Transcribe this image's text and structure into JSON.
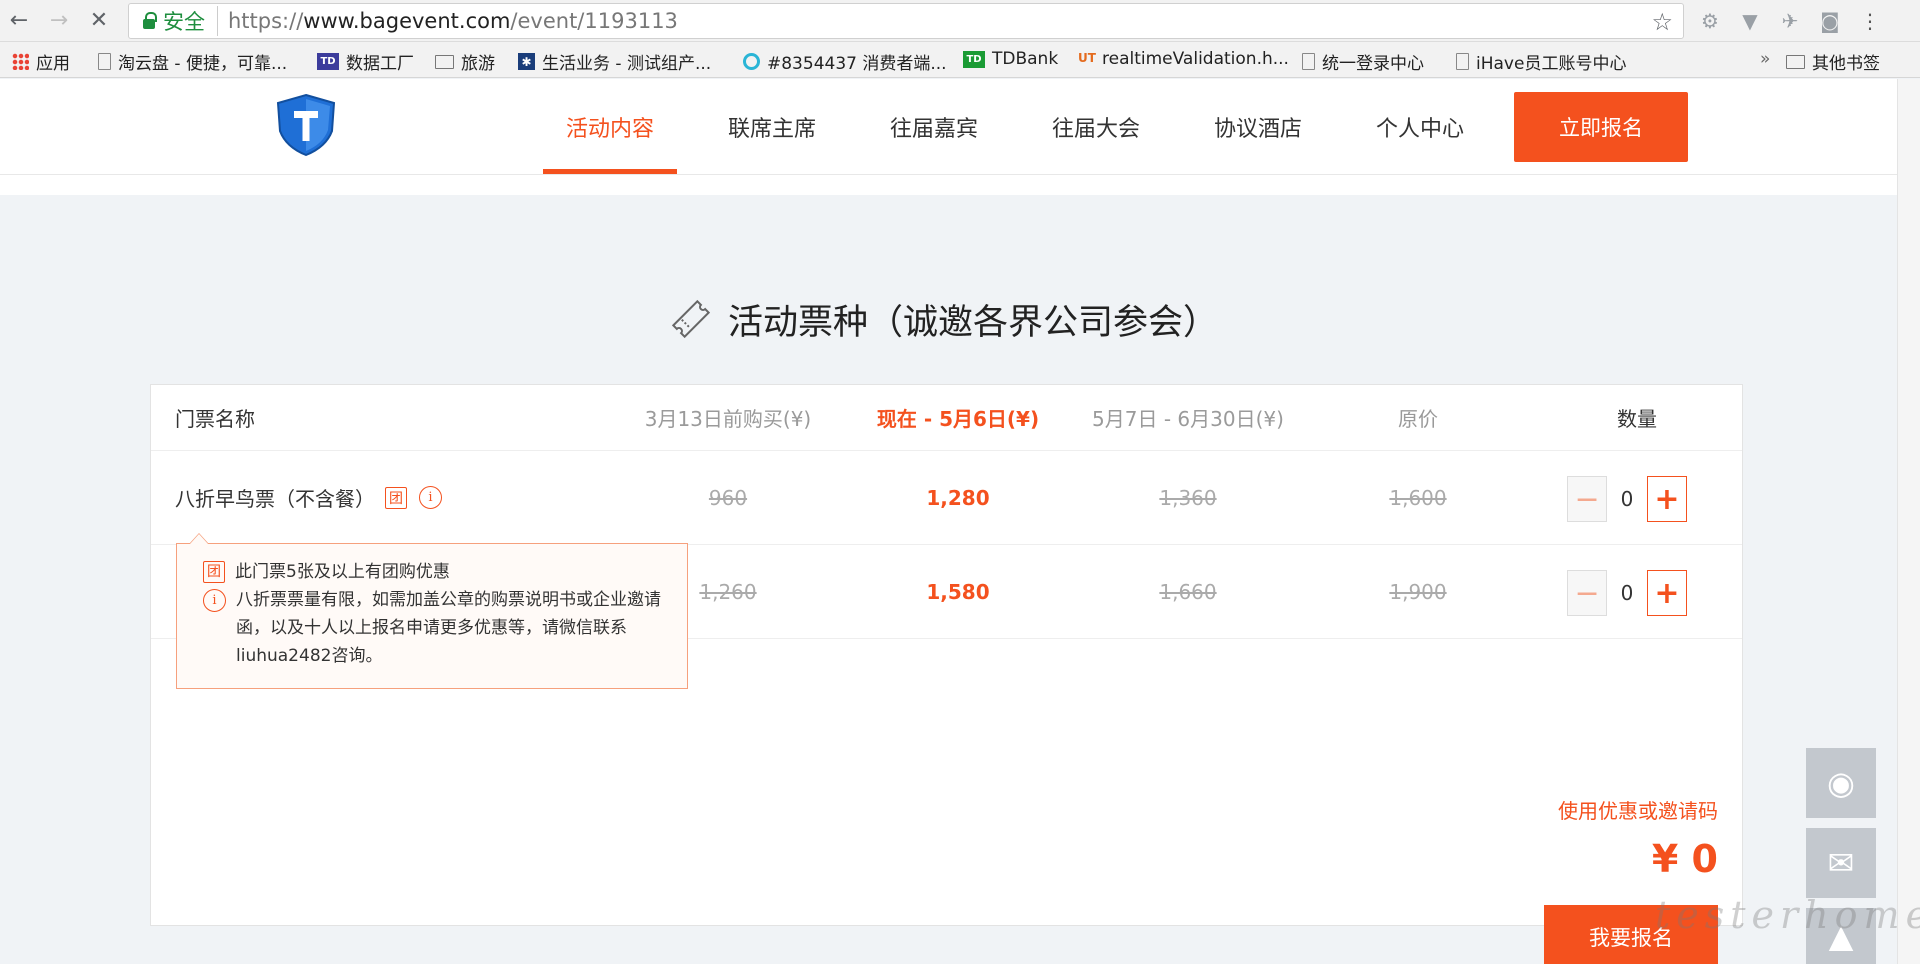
{
  "browser": {
    "secure_label": "安全",
    "url_scheme": "https://",
    "url_host": "www.bagevent.com",
    "url_path": "/event/1193113"
  },
  "bookmarks": [
    {
      "icon": "apps-icon",
      "label": "应用"
    },
    {
      "icon": "page-icon",
      "label": "淘云盘 - 便捷，可靠..."
    },
    {
      "icon": "td-icon",
      "label": "数据工厂"
    },
    {
      "icon": "folder-icon",
      "label": "旅游"
    },
    {
      "icon": "star-logo-icon",
      "label": "生活业务 - 测试组产..."
    },
    {
      "icon": "circle-logo-icon",
      "label": "#8354437 消费者端..."
    },
    {
      "icon": "tdbank-icon",
      "label": "TDBank"
    },
    {
      "icon": "ut-icon",
      "label": "realtimeValidation.h..."
    },
    {
      "icon": "page-icon",
      "label": "统一登录中心"
    },
    {
      "icon": "page-icon",
      "label": "iHave员工账号中心"
    }
  ],
  "bookmarks_more": "»",
  "bookmarks_other": "其他书签",
  "nav": {
    "items": [
      "活动内容",
      "联席主席",
      "往届嘉宾",
      "往届大会",
      "协议酒店",
      "个人中心"
    ],
    "active": "活动内容",
    "cta": "立即报名"
  },
  "section_title": "活动票种（诚邀各界公司参会）",
  "table": {
    "headers": [
      "门票名称",
      "3月13日前购买(¥)",
      "现在 - 5月6日(¥)",
      "5月7日 - 6月30日(¥)",
      "原价",
      "数量"
    ],
    "rows": [
      {
        "name": "八折早鸟票（不含餐）",
        "early": "960",
        "now": "1,280",
        "later": "1,360",
        "original": "1,600",
        "qty": "0"
      },
      {
        "name": "",
        "early": "1,260",
        "now": "1,580",
        "later": "1,660",
        "original": "1,900",
        "qty": "0"
      }
    ]
  },
  "tooltip": {
    "group_badge": "团",
    "group_text": "此门票5张及以上有团购优惠",
    "info_text": "八折票票量有限，如需加盖公章的购票说明书或企业邀请函，以及十人以上报名申请更多优惠等，请微信联系liuhua2482咨询。"
  },
  "summary": {
    "coupon_link": "使用优惠或邀请码",
    "total": "¥ 0",
    "submit": "我要报名"
  },
  "watermark": "testerhome.com",
  "colors": {
    "accent": "#f4511e",
    "background": "#f0f3f6"
  }
}
